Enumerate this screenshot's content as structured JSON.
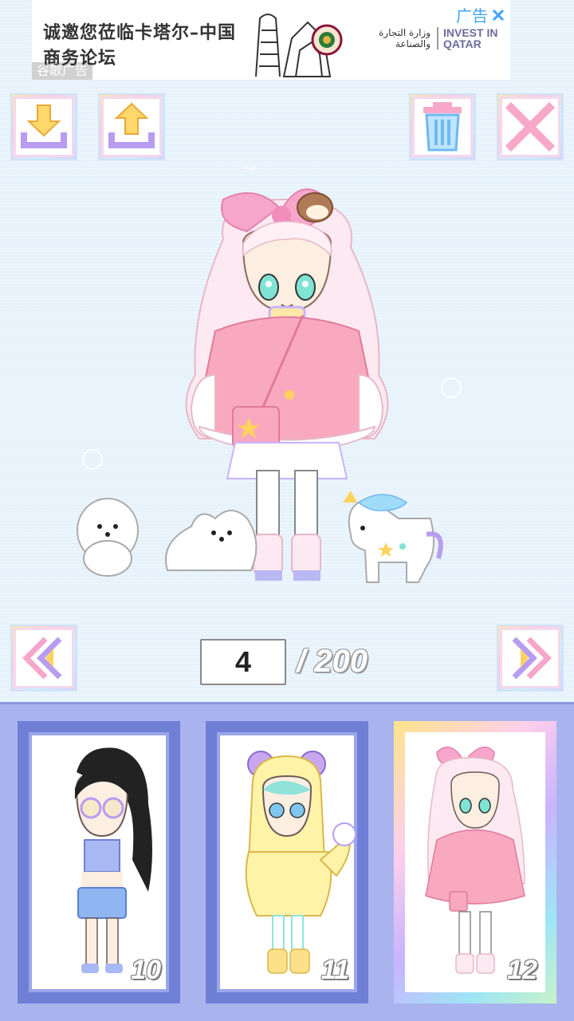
{
  "ad": {
    "headline": "诚邀您莅临卡塔尔–中国商务论坛",
    "label": "谷歌广告",
    "corner_label": "广告",
    "close_icon": "close-icon",
    "logo_text": "INVEST IN QATAR",
    "arabic_text": "وزارة التجارة والصناعة"
  },
  "toolbar": {
    "download_icon": "download-icon",
    "upload_icon": "upload-icon",
    "trash_icon": "trash-icon",
    "close_icon": "close-icon"
  },
  "pagination": {
    "current": "4",
    "total": "/ 200",
    "prev_icon": "double-chevron-left-icon",
    "next_icon": "double-chevron-right-icon"
  },
  "slots": [
    {
      "number": "10",
      "selected": false
    },
    {
      "number": "11",
      "selected": false
    },
    {
      "number": "12",
      "selected": true
    }
  ],
  "colors": {
    "background": "#e6f2fc",
    "panel": "#a9b4ee",
    "frame": "#6f7fd6",
    "accent_pink": "#f7a8c8",
    "accent_purple": "#b79cf0",
    "accent_yellow": "#ffd25e"
  }
}
